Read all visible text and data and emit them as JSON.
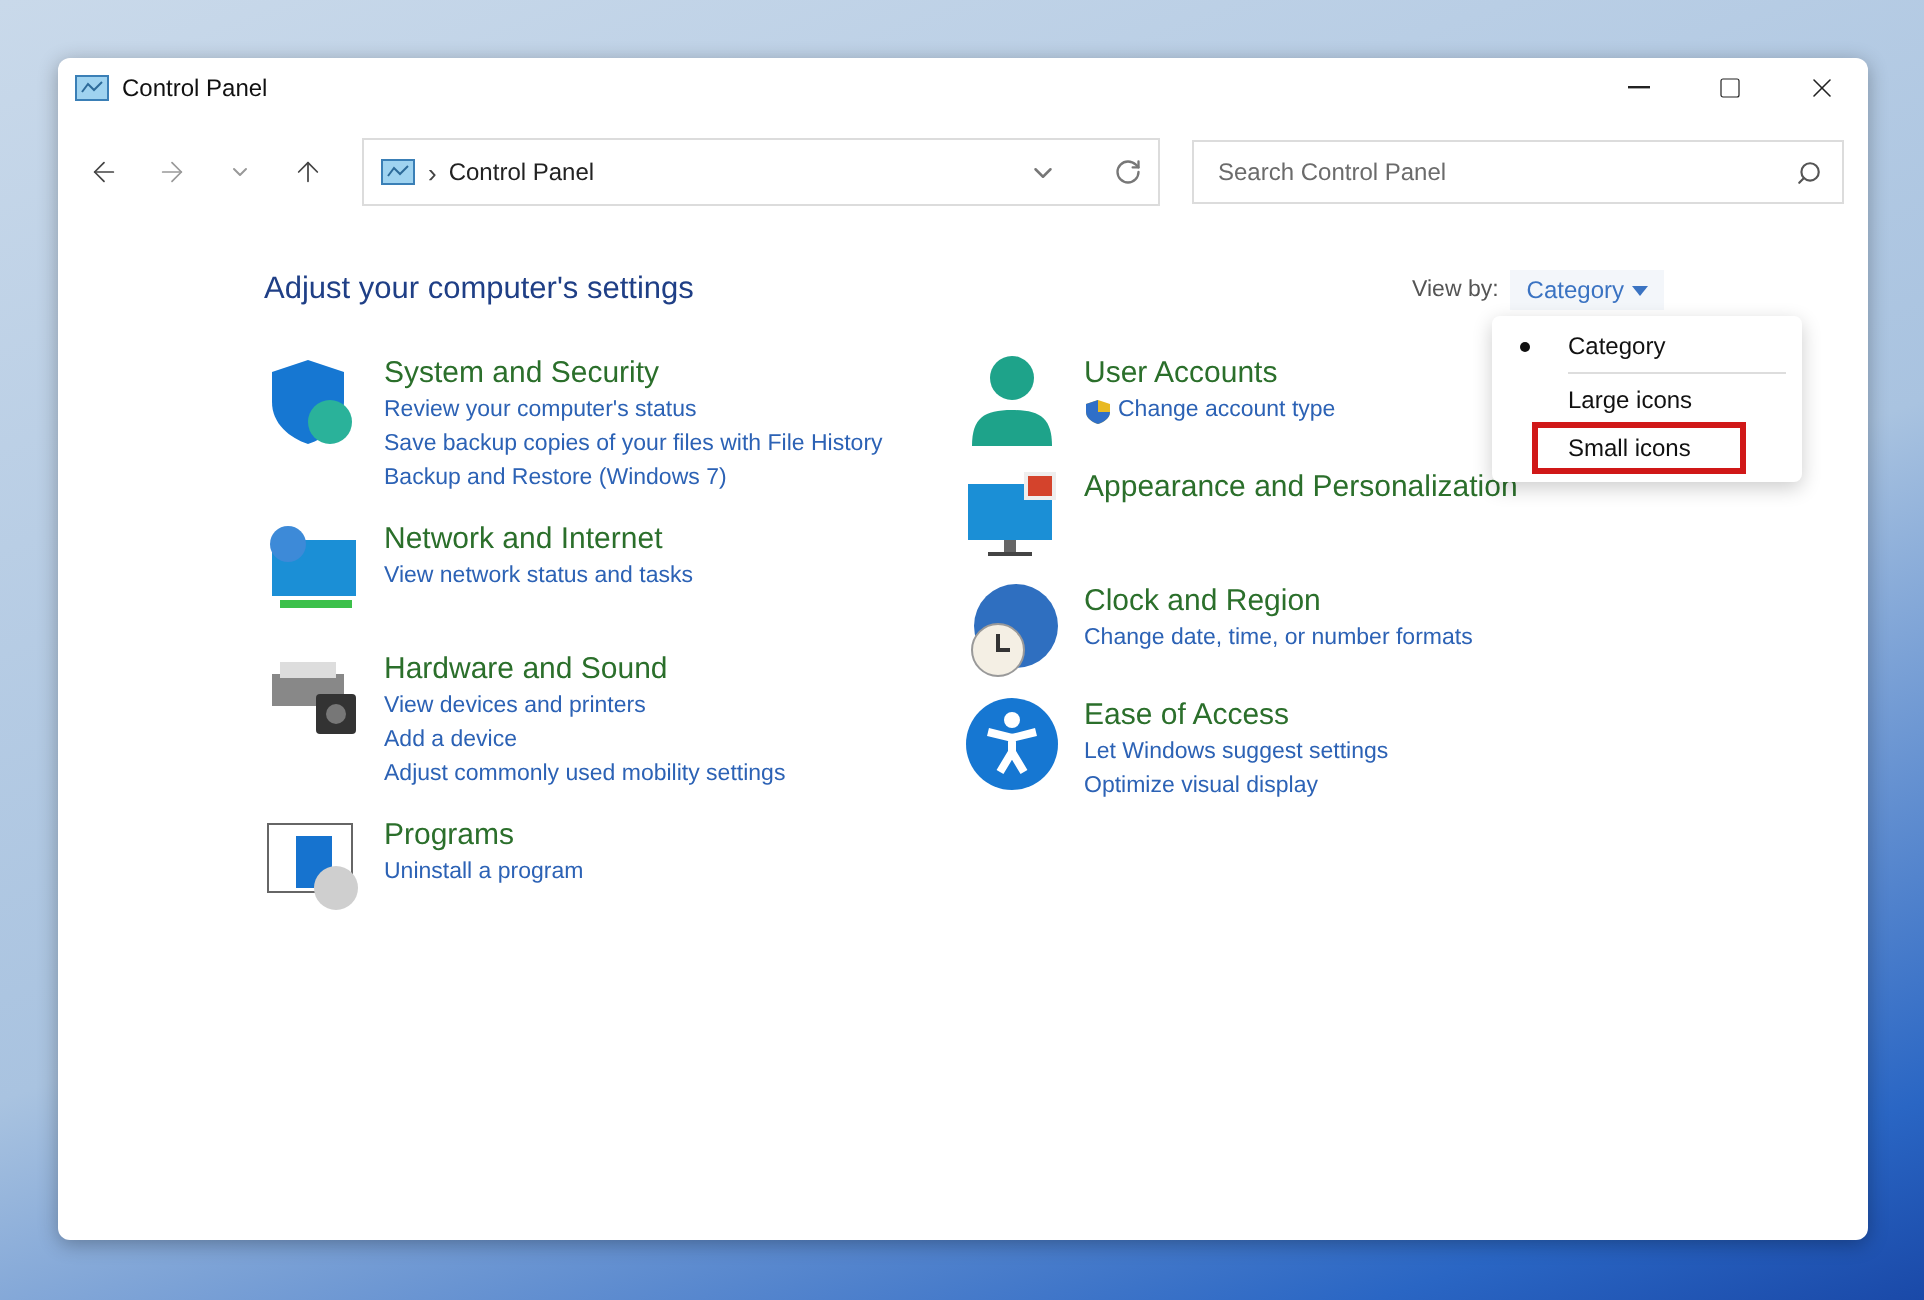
{
  "window": {
    "title": "Control Panel"
  },
  "address_bar": {
    "path": "Control Panel",
    "separator": "›"
  },
  "search": {
    "placeholder": "Search Control Panel"
  },
  "heading": "Adjust your computer's settings",
  "view_by": {
    "label": "View by:",
    "value": "Category",
    "menu": [
      {
        "label": "Category",
        "selected": true,
        "highlighted": false
      },
      {
        "label": "Large icons",
        "selected": false,
        "highlighted": false
      },
      {
        "label": "Small icons",
        "selected": false,
        "highlighted": true
      }
    ]
  },
  "columns": [
    [
      {
        "kind": "security",
        "title": "System and Security",
        "links": [
          {
            "text": "Review your computer's status",
            "shield": false
          },
          {
            "text": "Save backup copies of your files with File History",
            "shield": false
          },
          {
            "text": "Backup and Restore (Windows 7)",
            "shield": false
          }
        ]
      },
      {
        "kind": "network",
        "title": "Network and Internet",
        "links": [
          {
            "text": "View network status and tasks",
            "shield": false
          }
        ]
      },
      {
        "kind": "hardware",
        "title": "Hardware and Sound",
        "links": [
          {
            "text": "View devices and printers",
            "shield": false
          },
          {
            "text": "Add a device",
            "shield": false
          },
          {
            "text": "Adjust commonly used mobility settings",
            "shield": false
          }
        ]
      },
      {
        "kind": "programs",
        "title": "Programs",
        "links": [
          {
            "text": "Uninstall a program",
            "shield": false
          }
        ]
      }
    ],
    [
      {
        "kind": "user",
        "title": "User Accounts",
        "links": [
          {
            "text": "Change account type",
            "shield": true
          }
        ]
      },
      {
        "kind": "appearance",
        "title": "Appearance and Personalization"
      },
      {
        "kind": "clock",
        "title": "Clock and Region",
        "links": [
          {
            "text": "Change date, time, or number formats",
            "shield": false
          }
        ]
      },
      {
        "kind": "access",
        "title": "Ease of Access",
        "links": [
          {
            "text": "Let Windows suggest settings",
            "shield": false
          },
          {
            "text": "Optimize visual display",
            "shield": false
          }
        ]
      }
    ]
  ]
}
